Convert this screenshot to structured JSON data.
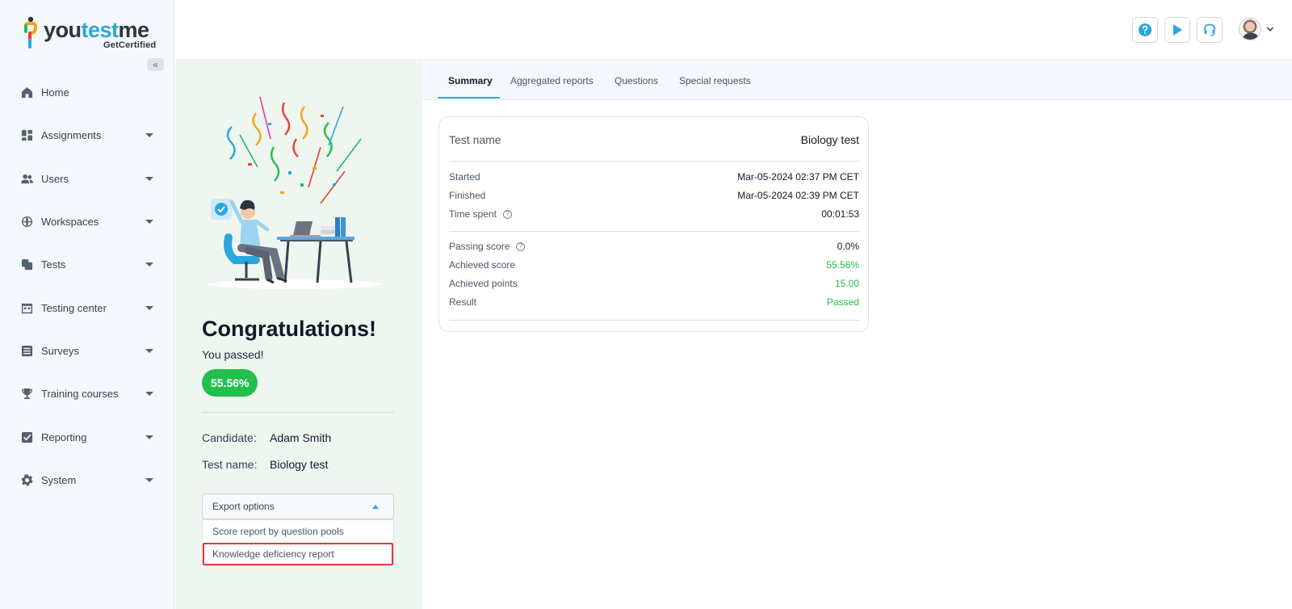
{
  "brand": {
    "name_part1": "you",
    "name_part2": "test",
    "name_part3": "me",
    "subtitle": "GetCertified"
  },
  "sidebar": {
    "items": [
      {
        "label": "Home",
        "icon": "home-icon",
        "has_caret": false
      },
      {
        "label": "Assignments",
        "icon": "dashboard-icon",
        "has_caret": true
      },
      {
        "label": "Users",
        "icon": "users-icon",
        "has_caret": true
      },
      {
        "label": "Workspaces",
        "icon": "globe-icon",
        "has_caret": true
      },
      {
        "label": "Tests",
        "icon": "copy-icon",
        "has_caret": true
      },
      {
        "label": "Testing center",
        "icon": "calendar-icon",
        "has_caret": true
      },
      {
        "label": "Surveys",
        "icon": "list-icon",
        "has_caret": true
      },
      {
        "label": "Training courses",
        "icon": "trophy-icon",
        "has_caret": true
      },
      {
        "label": "Reporting",
        "icon": "report-icon",
        "has_caret": true
      },
      {
        "label": "System",
        "icon": "gear-icon",
        "has_caret": true
      }
    ]
  },
  "header": {
    "buttons": [
      "help-icon",
      "play-icon",
      "headset-icon"
    ],
    "accent": "#2aa7df"
  },
  "result": {
    "title": "Congratulations!",
    "status_text": "You passed!",
    "score": "55.56%",
    "candidate_label": "Candidate:",
    "candidate_value": "Adam Smith",
    "test_label": "Test name:",
    "test_value": "Biology test",
    "export_label": "Export options",
    "export_options": [
      "Score report by question pools",
      "Knowledge deficiency report"
    ],
    "pass_color": "#22bf4c",
    "highlight_color": "#e23b3b"
  },
  "tabs": [
    {
      "label": "Summary",
      "active": true
    },
    {
      "label": "Aggregated reports",
      "active": false
    },
    {
      "label": "Questions",
      "active": false
    },
    {
      "label": "Special requests",
      "active": false
    }
  ],
  "summary": {
    "test_name_label": "Test name",
    "test_name_value": "Biology test",
    "started_label": "Started",
    "started_value": "Mar-05-2024 02:37 PM CET",
    "finished_label": "Finished",
    "finished_value": "Mar-05-2024 02:39 PM CET",
    "time_spent_label": "Time spent",
    "time_spent_value": "00:01:53",
    "passing_score_label": "Passing score",
    "passing_score_value": "0.0%",
    "achieved_score_label": "Achieved score",
    "achieved_score_value": "55.56%",
    "achieved_points_label": "Achieved points",
    "achieved_points_value": "15.00",
    "result_label": "Result",
    "result_value": "Passed"
  }
}
